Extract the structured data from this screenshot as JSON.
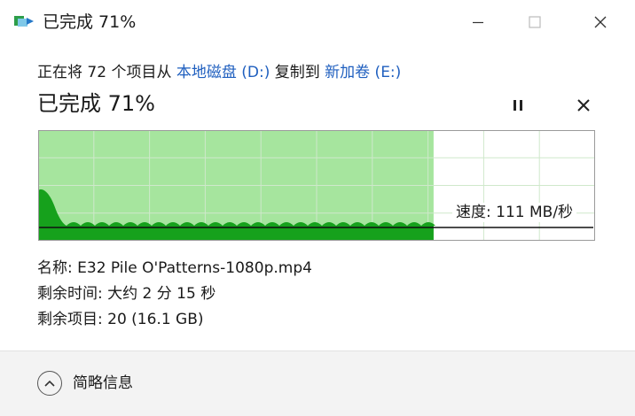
{
  "window": {
    "title": "已完成 71%",
    "controls": [
      "minimize-icon",
      "maximize-icon",
      "close-icon"
    ]
  },
  "copy": {
    "prefix": "正在将 72 个项目从 ",
    "source": "本地磁盘 (D:)",
    "middle": " 复制到 ",
    "destination": "新加卷 (E:)"
  },
  "progress": {
    "title": "已完成 71%",
    "percent": 71,
    "pause_icon": "pause-icon",
    "cancel_icon": "close-icon"
  },
  "speed": {
    "label": "速度: 111 MB/秒"
  },
  "details": {
    "name": "名称: E32 Pile O'Patterns-1080p.mp4",
    "time_remaining": "剩余时间: 大约 2 分 15 秒",
    "items_remaining": "剩余项目: 20 (16.1 GB)"
  },
  "footer": {
    "less_info_label": "简略信息",
    "less_info_icon": "chevron-up-icon"
  },
  "colors": {
    "graph_fill": "#a6e59e",
    "graph_line": "#16a11c",
    "graph_grid": "#cfe8cb",
    "link": "#1f5fbf"
  }
}
